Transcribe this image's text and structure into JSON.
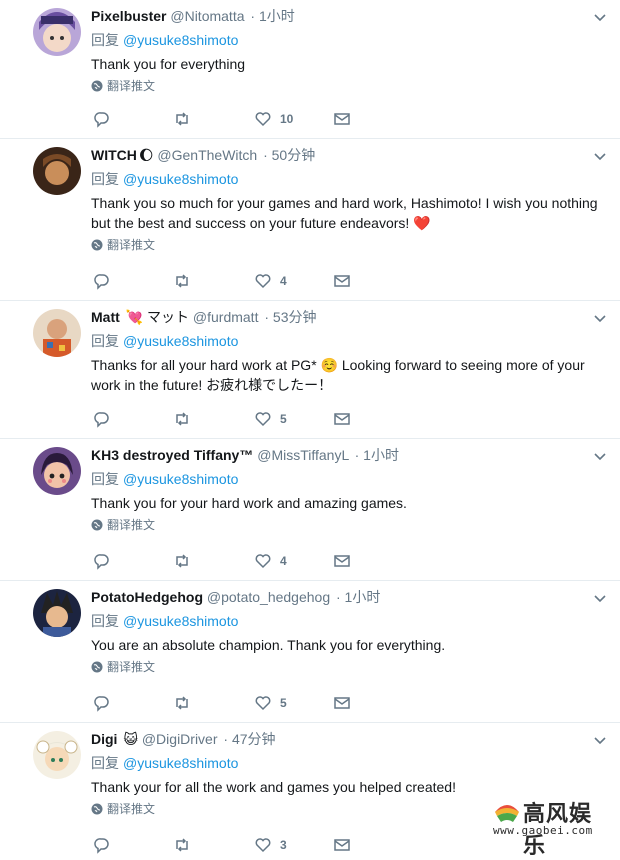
{
  "reply_label": "回复",
  "translate_label": "翻译推文",
  "tweets": [
    {
      "name": "Pixelbuster",
      "emoji": "",
      "handle": "@Nitomatta",
      "time": "· 1小时",
      "mention": "@yusuke8shimoto",
      "text": "Thank you for everything",
      "has_translate": true,
      "reply_count": "",
      "retweet_count": "",
      "like_count": "10",
      "avatar_color": "#6a4fa0"
    },
    {
      "name": "WITCH",
      "emoji": "🌔",
      "handle": "@GenTheWitch",
      "time": "· 50分钟",
      "mention": "@yusuke8shimoto",
      "text": "Thank you so much for your games and hard work, Hashimoto! I wish you nothing but the best and success on your future endeavors! ❤️",
      "has_translate": true,
      "reply_count": "",
      "retweet_count": "",
      "like_count": "4",
      "avatar_color": "#5a3b2a"
    },
    {
      "name": "Matt",
      "emoji": "💘 マット",
      "handle": "@furdmatt",
      "time": "· 53分钟",
      "mention": "@yusuke8shimoto",
      "text": "Thanks for all your hard work at PG* ☺️ Looking forward to seeing more of your work in the future! お疲れ様でしたー！",
      "has_translate": false,
      "reply_count": "",
      "retweet_count": "",
      "like_count": "5",
      "avatar_color": "#c46b3c"
    },
    {
      "name": "KH3 destroyed Tiffany™",
      "emoji": "",
      "handle": "@MissTiffanyL",
      "time": "· 1小时",
      "mention": "@yusuke8shimoto",
      "text": "Thank you for your hard work and amazing games.",
      "has_translate": true,
      "reply_count": "",
      "retweet_count": "",
      "like_count": "4",
      "avatar_color": "#3b2a55"
    },
    {
      "name": "PotatoHedgehog",
      "emoji": "",
      "handle": "@potato_hedgehog",
      "time": "· 1小时",
      "mention": "@yusuke8shimoto",
      "text": "You are an absolute champion. Thank you for everything.",
      "has_translate": true,
      "reply_count": "",
      "retweet_count": "",
      "like_count": "5",
      "avatar_color": "#2c3e66"
    },
    {
      "name": "Digi",
      "emoji": "😺",
      "handle": "@DigiDriver",
      "time": "· 47分钟",
      "mention": "@yusuke8shimoto",
      "text": "Thank your for all the work and games you helped created!",
      "has_translate": true,
      "reply_count": "",
      "retweet_count": "",
      "like_count": "3",
      "avatar_color": "#d9c9a3"
    }
  ],
  "watermark": {
    "title": "高风娱乐",
    "url": "www.gaobei.com"
  }
}
